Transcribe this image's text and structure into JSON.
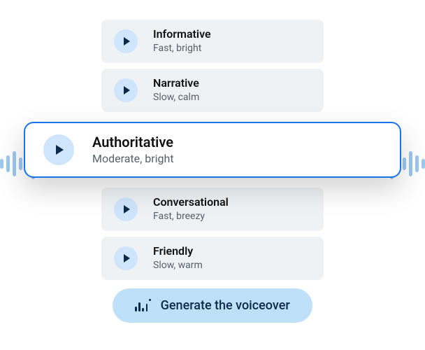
{
  "voices": [
    {
      "title": "Informative",
      "subtitle": "Fast, bright",
      "selected": false
    },
    {
      "title": "Narrative",
      "subtitle": "Slow, calm",
      "selected": false
    },
    {
      "title": "Authoritative",
      "subtitle": "Moderate, bright",
      "selected": true
    },
    {
      "title": "Conversational",
      "subtitle": "Fast, breezy",
      "selected": false
    },
    {
      "title": "Friendly",
      "subtitle": "Slow, warm",
      "selected": false
    }
  ],
  "generate_label": "Generate the voiceover"
}
